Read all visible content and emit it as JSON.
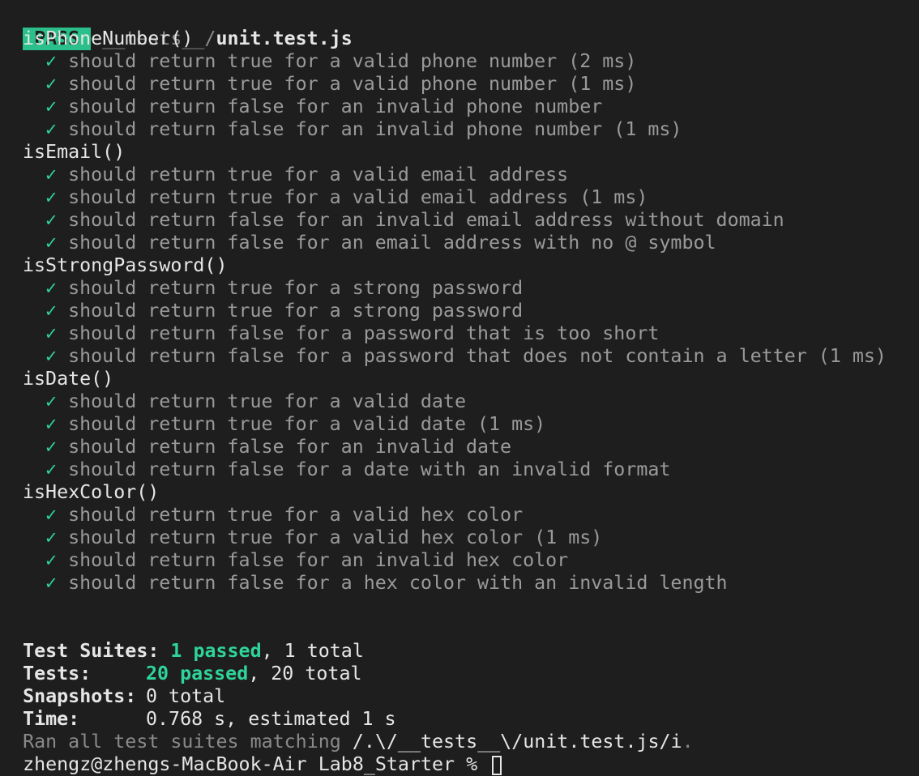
{
  "header": {
    "status": "PASS",
    "path_dir": "__tests__/",
    "path_file": "unit.test.js"
  },
  "suites": [
    {
      "name": "isPhoneNumber()",
      "tests": [
        "should return true for a valid phone number (2 ms)",
        "should return true for a valid phone number (1 ms)",
        "should return false for an invalid phone number",
        "should return false for an invalid phone number (1 ms)"
      ]
    },
    {
      "name": "isEmail()",
      "tests": [
        "should return true for a valid email address",
        "should return true for a valid email address (1 ms)",
        "should return false for an invalid email address without domain",
        "should return false for an email address with no @ symbol"
      ]
    },
    {
      "name": "isStrongPassword()",
      "tests": [
        "should return true for a strong password",
        "should return true for a strong password",
        "should return false for a password that is too short",
        "should return false for a password that does not contain a letter (1 ms)"
      ]
    },
    {
      "name": "isDate()",
      "tests": [
        "should return true for a valid date",
        "should return true for a valid date (1 ms)",
        "should return false for an invalid date",
        "should return false for a date with an invalid format"
      ]
    },
    {
      "name": "isHexColor()",
      "tests": [
        "should return true for a valid hex color",
        "should return true for a valid hex color (1 ms)",
        "should return false for an invalid hex color",
        "should return false for a hex color with an invalid length"
      ]
    }
  ],
  "check_glyph": "✓",
  "summary": {
    "suites_label": "Test Suites:",
    "suites_passed": "1 passed",
    "suites_total": ", 1 total",
    "tests_label": "Tests:",
    "tests_passed": "20 passed",
    "tests_total": ", 20 total",
    "snapshots_label": "Snapshots:",
    "snapshots_value": "0 total",
    "time_label": "Time:",
    "time_value": "0.768 s, estimated 1 s",
    "ran_prefix": "Ran all test suites matching ",
    "ran_pattern": "/.\\/__tests__\\/unit.test.js/i",
    "ran_suffix": "."
  },
  "prompt": {
    "text": "zhengz@zhengs-MacBook-Air Lab8_Starter % "
  },
  "colors": {
    "background": "#1e1e1e",
    "pass_badge": "#2bc08b",
    "green": "#2fd49a",
    "dim": "#8a8a8a"
  }
}
